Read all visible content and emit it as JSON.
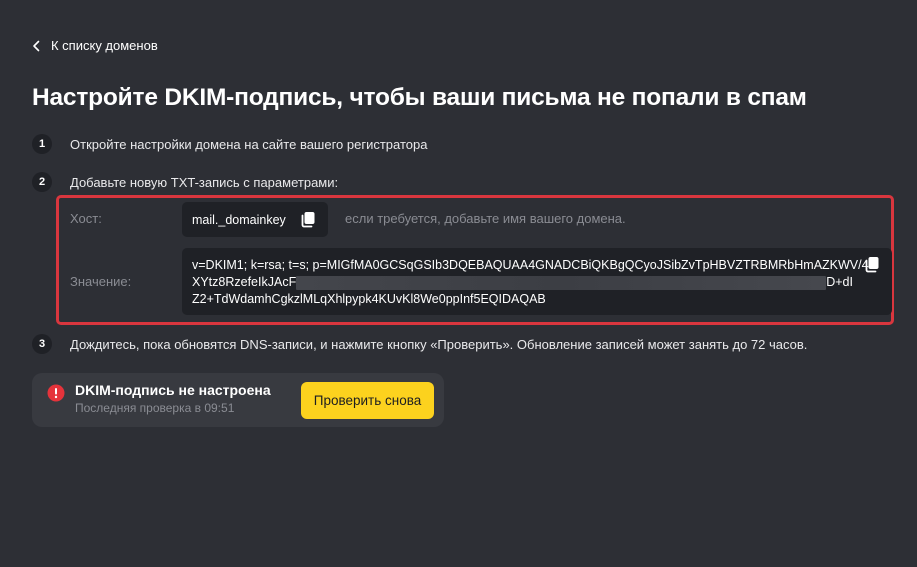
{
  "back_link": {
    "label": "К списку доменов"
  },
  "page_title": "Настройте DKIM-подпись, чтобы ваши письма не попали в спам",
  "steps": [
    {
      "number": "1",
      "text": "Откройте настройки домена на сайте вашего регистратора"
    },
    {
      "number": "2",
      "text": "Добавьте новую TXT-запись с параметрами:"
    },
    {
      "number": "3",
      "text": "Дождитесь, пока обновятся DNS-записи, и нажмите кнопку «Проверить». Обновление записей может занять до 72 часов."
    }
  ],
  "params": {
    "host_label": "Хост:",
    "host_value": "mail._domainkey",
    "host_hint": "если требуется, добавьте имя вашего домена.",
    "value_label": "Значение:",
    "value_lines": {
      "line1": "v=DKIM1; k=rsa; t=s; p=MIGfMA0GCSqGSIb3DQEBAQUAA4GNADCBiQKBgQCyoJSibZvTpHBVZTRBMRbHmAZKWV/4",
      "line2_start": "XYtz8RzefeIkJAcF",
      "line2_end": "D+dI",
      "line3": "Z2+TdWdamhCgkzlMLqXhlpypk4KUvKl8We0ppInf5EQIDAQAB"
    },
    "copy_icon": "copy-icon"
  },
  "status": {
    "icon": "alert-icon",
    "title": "DKIM-подпись не настроена",
    "subtitle": "Последняя проверка в 09:51",
    "button_label": "Проверить снова"
  },
  "colors": {
    "background": "#2d2f35",
    "highlight_border": "#d9363e",
    "accent_button": "#fcd21e",
    "alert_red": "#e5333b"
  }
}
